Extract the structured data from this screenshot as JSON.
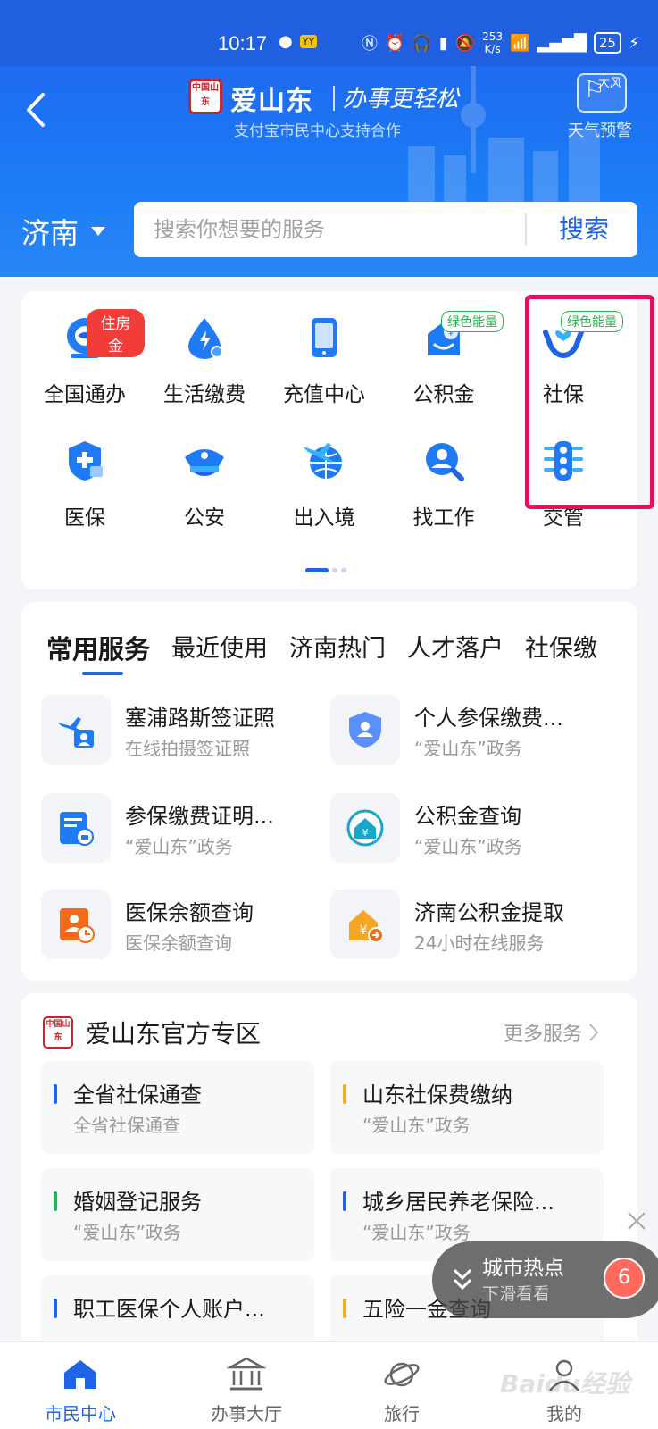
{
  "status_bar": {
    "time": "10:17",
    "speed": "253",
    "speed_unit": "K/s",
    "battery": "25"
  },
  "header": {
    "brand": "爱山东",
    "slogan": "办事更轻松",
    "subtitle": "支付宝市民中心支持合作",
    "weather_icon_text": "大风",
    "weather_label": "天气预警",
    "seal_text": "中国山东"
  },
  "search": {
    "city": "济南",
    "placeholder": "搜索你想要的服务",
    "button": "搜索"
  },
  "grid": {
    "items": [
      {
        "label": "全国通办",
        "badge": "住房金"
      },
      {
        "label": "生活缴费"
      },
      {
        "label": "充值中心"
      },
      {
        "label": "公积金",
        "badge": "绿色能量"
      },
      {
        "label": "社保",
        "badge": "绿色能量"
      },
      {
        "label": "医保"
      },
      {
        "label": "公安"
      },
      {
        "label": "出入境"
      },
      {
        "label": "找工作"
      },
      {
        "label": "交管"
      }
    ]
  },
  "services": {
    "tabs": [
      "常用服务",
      "最近使用",
      "济南热门",
      "人才落户",
      "社保缴"
    ],
    "items": [
      {
        "title": "塞浦路斯签证照",
        "sub": "在线拍摄签证照"
      },
      {
        "title": "个人参保缴费...",
        "sub": "“爱山东”政务"
      },
      {
        "title": "参保缴费证明...",
        "sub": "“爱山东”政务"
      },
      {
        "title": "公积金查询",
        "sub": "“爱山东”政务"
      },
      {
        "title": "医保余额查询",
        "sub": "医保余额查询"
      },
      {
        "title": "济南公积金提取",
        "sub": "24小时在线服务"
      }
    ]
  },
  "official": {
    "title": "爱山东官方专区",
    "more": "更多服务",
    "tiles": [
      {
        "title": "全省社保通查",
        "sub": "全省社保通查",
        "color": "#1f63e6"
      },
      {
        "title": "山东社保费缴纳",
        "sub": "“爱山东”政务",
        "color": "#f2b11a"
      },
      {
        "title": "婚姻登记服务",
        "sub": "“爱山东”政务",
        "color": "#27b05a"
      },
      {
        "title": "城乡居民养老保险...",
        "sub": "“爱山东”政务",
        "color": "#1f63e6"
      },
      {
        "title": "职工医保个人账户...",
        "sub": "",
        "color": "#1f63e6"
      },
      {
        "title": "五险一金查询",
        "sub": "",
        "color": "#f2b11a"
      }
    ]
  },
  "hot": {
    "title": "城市热点",
    "sub": "下滑看看",
    "count": "6"
  },
  "nav": [
    {
      "label": "市民中心"
    },
    {
      "label": "办事大厅"
    },
    {
      "label": "旅行"
    },
    {
      "label": "我的"
    }
  ],
  "watermark": "Baidu经验",
  "colors": {
    "primary": "#1f63e6",
    "header": "#1b7cf5",
    "highlight": "#e0115f"
  }
}
